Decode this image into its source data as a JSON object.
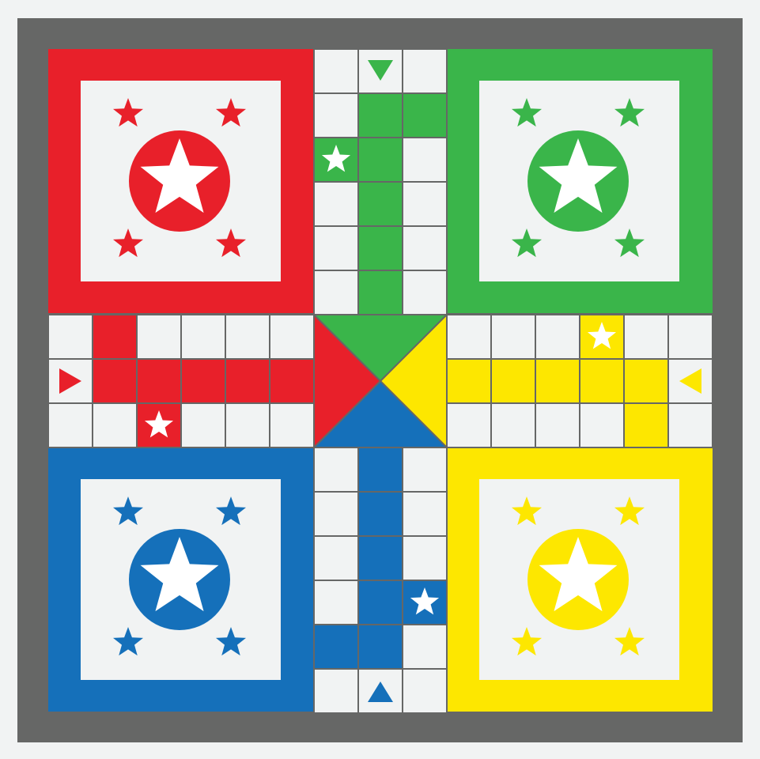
{
  "colors": {
    "background": "#f1f3f3",
    "frame": "#666766",
    "cell": "#f1f3f3",
    "grid_line": "#666766",
    "star_white": "#ffffff",
    "red": "#e8202a",
    "green": "#3ab54a",
    "yellow": "#fde700",
    "blue": "#1570ba"
  },
  "players": [
    {
      "id": "red",
      "quadrant": "top-left",
      "home_tokens": 4,
      "home_icon": "star-icon",
      "entry_arrow": "triangle-right-icon"
    },
    {
      "id": "green",
      "quadrant": "top-right",
      "home_tokens": 4,
      "home_icon": "star-icon",
      "entry_arrow": "triangle-down-icon"
    },
    {
      "id": "blue",
      "quadrant": "bottom-left",
      "home_tokens": 4,
      "home_icon": "star-icon",
      "entry_arrow": "triangle-up-icon"
    },
    {
      "id": "yellow",
      "quadrant": "bottom-right",
      "home_tokens": 4,
      "home_icon": "star-icon",
      "entry_arrow": "triangle-left-icon"
    }
  ],
  "board": {
    "grid": 15,
    "center_triangles": [
      "red",
      "green",
      "yellow",
      "blue"
    ]
  }
}
